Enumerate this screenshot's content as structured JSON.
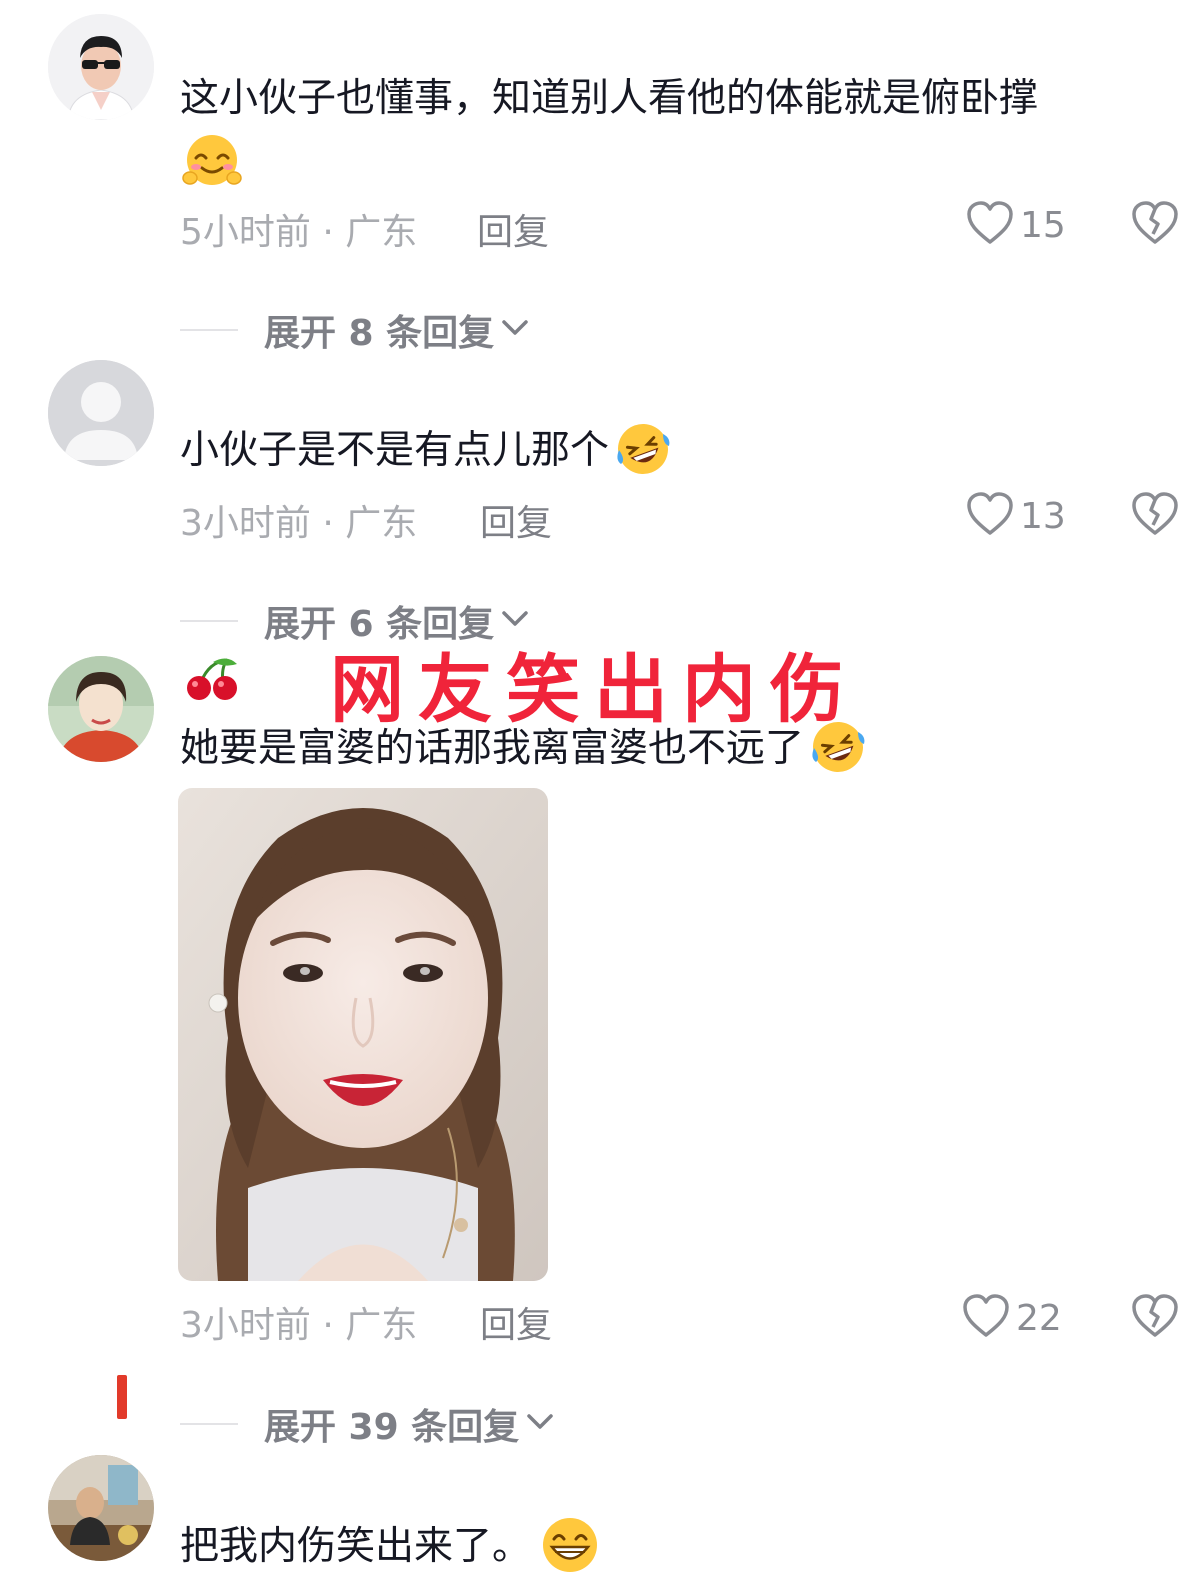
{
  "comments": [
    {
      "text": "这小伙子也懂事，知道别人看他的体能就是俯卧撑",
      "meta": "5小时前 · 广东",
      "reply_label": "回复",
      "likes": "15",
      "expand_label": "展开 8 条回复"
    },
    {
      "text": "小伙子是不是有点儿那个",
      "meta": "3小时前 · 广东",
      "reply_label": "回复",
      "likes": "13",
      "expand_label": "展开 6 条回复"
    },
    {
      "text": "她要是富婆的话那我离富婆也不远了",
      "meta": "3小时前 · 广东",
      "reply_label": "回复",
      "likes": "22",
      "expand_label": "展开 39 条回复"
    },
    {
      "text": "把我内伤笑出来了。"
    }
  ],
  "overlay": {
    "title": "网友笑出内伤"
  },
  "icons": {
    "like": "heart-outline-icon",
    "dislike": "broken-heart-icon",
    "expand": "chevron-down-icon",
    "username_badge": "cherry-icon"
  },
  "colors": {
    "overlay_red": "#f0243a",
    "meta_gray": "#a9abb0",
    "text_dark": "#161823"
  }
}
